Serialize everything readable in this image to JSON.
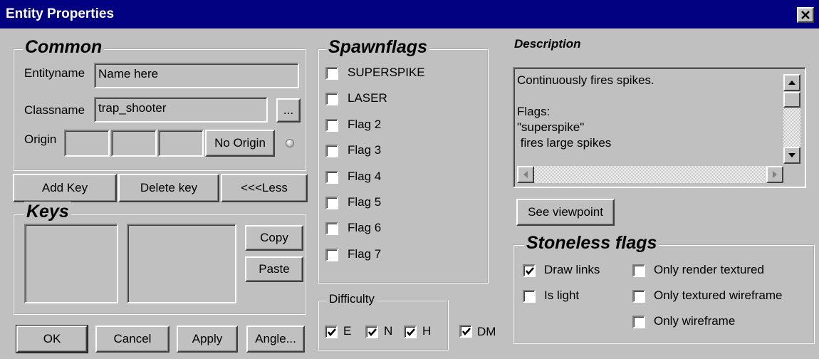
{
  "window": {
    "title": "Entity Properties"
  },
  "common": {
    "label": "Common",
    "entityname_label": "Entityname",
    "entityname_value": "Name here",
    "classname_label": "Classname",
    "classname_value": "trap_shooter",
    "browse_label": "...",
    "origin_label": "Origin",
    "no_origin_label": "No Origin"
  },
  "key_buttons": {
    "add": "Add Key",
    "delete": "Delete key",
    "less": "<<<Less"
  },
  "keys": {
    "label": "Keys",
    "copy": "Copy",
    "paste": "Paste"
  },
  "bottom_buttons": {
    "ok": "OK",
    "cancel": "Cancel",
    "apply": "Apply",
    "angle": "Angle..."
  },
  "spawnflags": {
    "label": "Spawnflags",
    "items": [
      {
        "label": "SUPERSPIKE",
        "checked": false
      },
      {
        "label": "LASER",
        "checked": false
      },
      {
        "label": "Flag 2",
        "checked": false
      },
      {
        "label": "Flag 3",
        "checked": false
      },
      {
        "label": "Flag 4",
        "checked": false
      },
      {
        "label": "Flag 5",
        "checked": false
      },
      {
        "label": "Flag 6",
        "checked": false
      },
      {
        "label": "Flag 7",
        "checked": false
      }
    ]
  },
  "difficulty": {
    "label": "Difficulty",
    "items": [
      {
        "label": "E",
        "checked": true
      },
      {
        "label": "N",
        "checked": true
      },
      {
        "label": "H",
        "checked": true
      }
    ],
    "dm": {
      "label": "DM",
      "checked": true
    }
  },
  "description": {
    "label": "Description",
    "lines": [
      "Continuously fires spikes.",
      "",
      "Flags:",
      "\"superspike\"",
      " fires large spikes"
    ]
  },
  "see_viewpoint": "See viewpoint",
  "stoneless": {
    "label": "Stoneless flags",
    "items": [
      {
        "label": "Draw links",
        "checked": true
      },
      {
        "label": "Is light",
        "checked": false
      },
      {
        "label": "Only render textured",
        "checked": false
      },
      {
        "label": "Only textured wireframe",
        "checked": false
      },
      {
        "label": "Only wireframe",
        "checked": false
      }
    ]
  },
  "colors": {
    "titlebar": "#000080",
    "face": "#c0c0c0"
  }
}
